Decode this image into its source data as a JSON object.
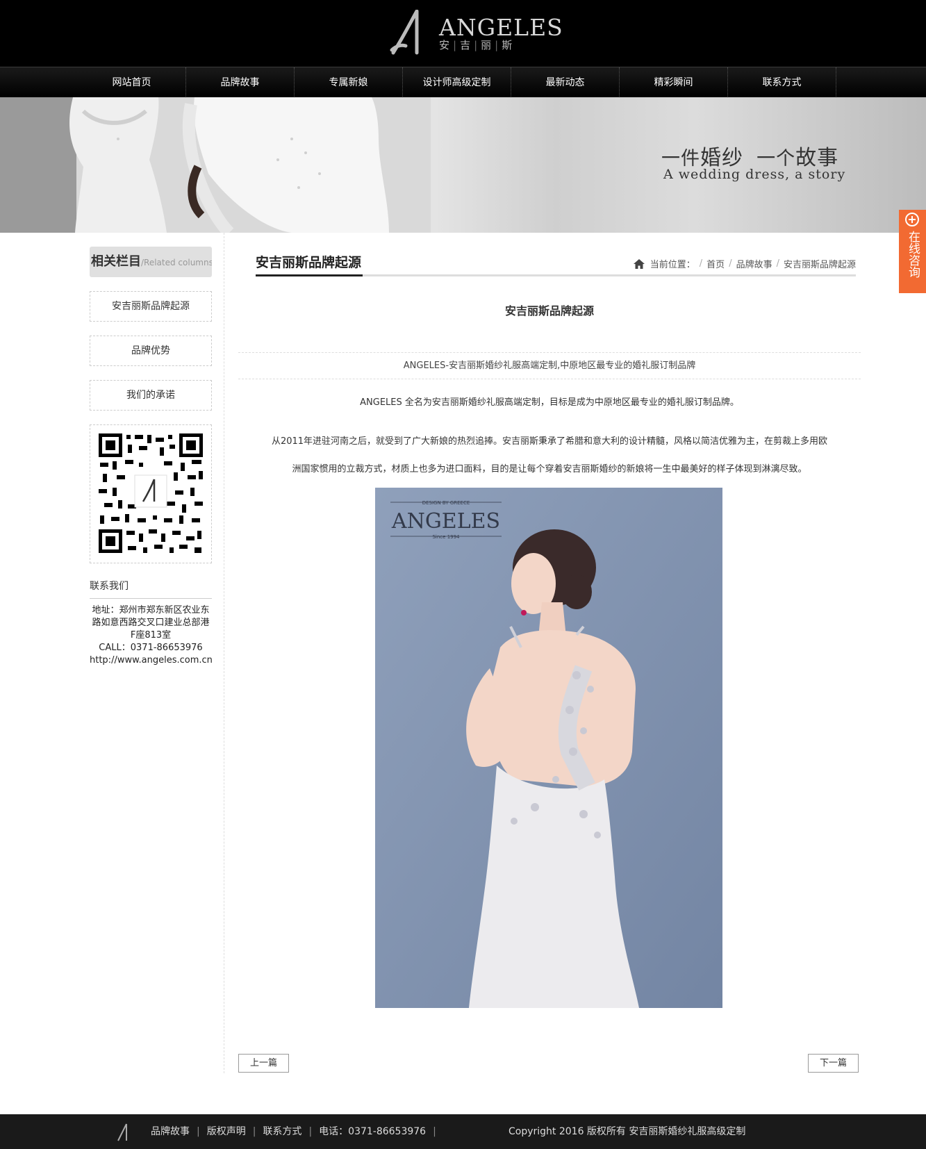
{
  "brand": {
    "logo_word": "ANGELES",
    "logo_sub": [
      "安",
      "吉",
      "丽",
      "斯"
    ]
  },
  "nav": {
    "items": [
      {
        "label": "网站首页"
      },
      {
        "label": "品牌故事"
      },
      {
        "label": "专属新娘"
      },
      {
        "label": "设计师高级定制"
      },
      {
        "label": "最新动态"
      },
      {
        "label": "精彩瞬间"
      },
      {
        "label": "联系方式"
      }
    ]
  },
  "banner": {
    "cn_part1_small": "一件",
    "cn_part1_big": "婚纱",
    "cn_part2_small": "一个",
    "cn_part2_big": "故事",
    "en": "A wedding dress, a story"
  },
  "consult": {
    "label": "在线咨询"
  },
  "sidebar": {
    "title_cn": "相关栏目",
    "title_en": "/Related columns",
    "links": [
      {
        "label": "安吉丽斯品牌起源"
      },
      {
        "label": "品牌优势"
      },
      {
        "label": "我们的承诺"
      }
    ],
    "contact_title": "联系我们",
    "contact_lines": [
      "地址：郑州市郑东新区农业东",
      "路如意西路交叉口建业总部港",
      "F座813室",
      "CALL：0371-86653976",
      "http://www.angeles.com.cn"
    ]
  },
  "main": {
    "title": "安吉丽斯品牌起源",
    "breadcrumb": {
      "prefix": "当前位置：",
      "items": [
        "首页",
        "品牌故事",
        "安吉丽斯品牌起源"
      ]
    },
    "article_title": "安吉丽斯品牌起源",
    "summary": "ANGELES-安吉丽斯婚纱礼服高端定制,中原地区最专业的婚礼服订制品牌",
    "paragraphs": [
      "ANGELES 全名为安吉丽斯婚纱礼服高端定制，目标是成为中原地区最专业的婚礼服订制品牌。",
      "从2011年进驻河南之后，就受到了广大新娘的热烈追捧。安吉丽斯秉承了希腊和意大利的设计精髓，风格以简洁优雅为主，在剪裁上多用欧",
      "洲国家惯用的立裁方式，材质上也多为进口面料，目的是让每个穿着安吉丽斯婚纱的新娘将一生中最美好的样子体现到淋漓尽致。"
    ],
    "photo": {
      "header_small": "DESIGN BY GREECE",
      "brand": "ANGELES",
      "since": "Since 1994"
    },
    "prev": "上一篇",
    "next": "下一篇"
  },
  "footer": {
    "links": [
      "品牌故事",
      "版权声明",
      "联系方式",
      "电话：0371-86653976"
    ],
    "copyright": "Copyright 2016 版权所有 安吉丽斯婚纱礼服高级定制"
  }
}
